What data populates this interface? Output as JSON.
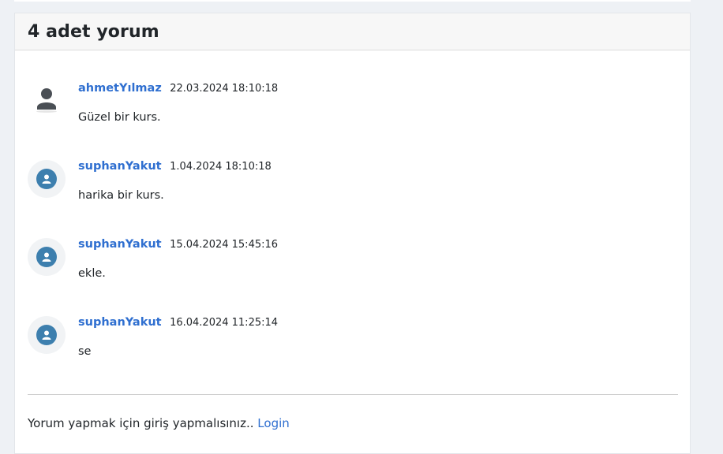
{
  "header": {
    "title": "4 adet yorum"
  },
  "comments": [
    {
      "avatar": "user-silhouette-icon",
      "username": "ahmetYılmaz",
      "date": "22.03.2024 18:10:18",
      "text": "Güzel bir kurs."
    },
    {
      "avatar": "user-circle-icon",
      "username": "suphanYakut",
      "date": "1.04.2024 18:10:18",
      "text": "harika bir kurs."
    },
    {
      "avatar": "user-circle-icon",
      "username": "suphanYakut",
      "date": "15.04.2024 15:45:16",
      "text": "ekle."
    },
    {
      "avatar": "user-circle-icon",
      "username": "suphanYakut",
      "date": "16.04.2024 11:25:14",
      "text": "se"
    }
  ],
  "footer": {
    "prompt": "Yorum yapmak için giriş yapmalısınız..",
    "login_label": "Login"
  },
  "colors": {
    "link": "#2f6fd0",
    "avatar_accent": "#3d7fae",
    "header_bg": "#f7f7f7",
    "page_bg": "#eef1f5"
  }
}
